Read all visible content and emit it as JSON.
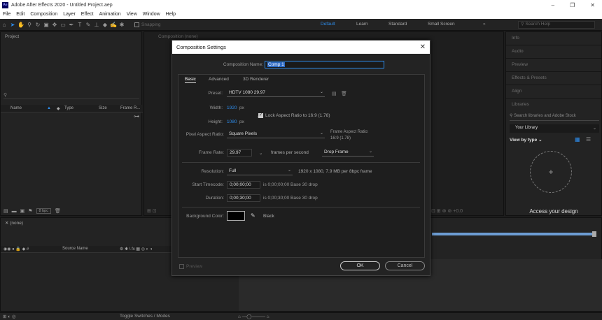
{
  "app": {
    "title": "Adobe After Effects 2020 - Untitled Project.aep",
    "icon": "Ae"
  },
  "menu": [
    "File",
    "Edit",
    "Composition",
    "Layer",
    "Effect",
    "Animation",
    "View",
    "Window",
    "Help"
  ],
  "toolbar": {
    "snapping": "Snapping",
    "workspaces": [
      "Default",
      "Learn",
      "Standard",
      "Small Screen"
    ],
    "search": "Search Help"
  },
  "project": {
    "title": "Project",
    "columns": {
      "name": "Name",
      "type": "Type",
      "size": "Size",
      "frame_rate": "Frame R..."
    },
    "bpc": "8 bpc"
  },
  "comp_viewer": {
    "tab": "Composition (none)"
  },
  "right_panel": {
    "items": [
      "Info",
      "Audio",
      "Preview",
      "Effects & Presets",
      "Align",
      "Libraries"
    ],
    "search_placeholder": "Search libraries and Adobe Stock",
    "library": "Your Library",
    "view_by": "View by type",
    "promo": "Access your design"
  },
  "timeline": {
    "tab": "(none)",
    "source_name": "Source Name",
    "toggle": "Toggle Switches / Modes"
  },
  "dialog": {
    "title": "Composition Settings",
    "comp_name_label": "Composition Name:",
    "comp_name": "Comp 1",
    "tabs": [
      "Basic",
      "Advanced",
      "3D Renderer"
    ],
    "preset_label": "Preset:",
    "preset": "HDTV 1080 29.97",
    "width_label": "Width:",
    "width": "1920",
    "height_label": "Height:",
    "height": "1080",
    "px": "px",
    "lock_label": "Lock Aspect Ratio to 16:9 (1.78)",
    "par_label": "Pixel Aspect Ratio:",
    "par": "Square Pixels",
    "frame_aspect_label": "Frame Aspect Ratio:",
    "frame_aspect": "16:9 (1.78)",
    "frame_rate_label": "Frame Rate:",
    "frame_rate": "29.97",
    "fps": "frames per second",
    "drop_frame": "Drop Frame",
    "resolution_label": "Resolution:",
    "resolution": "Full",
    "resolution_info": "1920 x 1080, 7.9 MB per 8bpc frame",
    "start_tc_label": "Start Timecode:",
    "start_tc": "0;00;00;00",
    "start_tc_info": "is 0;00;00;00  Base 30  drop",
    "duration_label": "Duration:",
    "duration": "0;00;30;00",
    "duration_info": "is 0;00;30;00  Base 30  drop",
    "bg_label": "Background Color:",
    "bg_color_name": "Black",
    "bg_color": "#000000",
    "preview": "Preview",
    "ok": "OK",
    "cancel": "Cancel"
  }
}
